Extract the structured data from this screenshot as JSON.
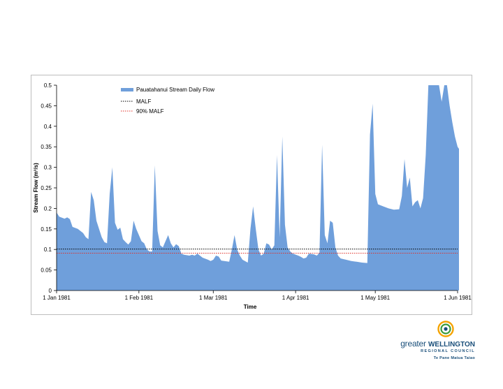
{
  "chart_data": {
    "type": "area",
    "title": "",
    "xlabel": "Time",
    "ylabel": "Stream Flow (m³/s)",
    "ylim": [
      0,
      0.5
    ],
    "y_ticks": [
      "0",
      "0.05",
      "0.1",
      "0.15",
      "0.2",
      "0.25",
      "0.3",
      "0.35",
      "0.4",
      "0.45",
      "0.5"
    ],
    "x_ticks": [
      "1 Jan 1981",
      "1 Feb 1981",
      "1 Mar 1981",
      "1 Apr 1981",
      "1 May 1981",
      "1 Jun 1981"
    ],
    "x_range": [
      "1981-01-01",
      "1981-06-01"
    ],
    "grid": false,
    "legend_position": "top-left",
    "series": [
      {
        "name": "Pauatahanui Stream Daily Flow",
        "style": "area",
        "color": "#6f9fdb",
        "points": [
          [
            "1981-01-01",
            0.19
          ],
          [
            "1981-01-02",
            0.18
          ],
          [
            "1981-01-04",
            0.175
          ],
          [
            "1981-01-05",
            0.178
          ],
          [
            "1981-01-06",
            0.174
          ],
          [
            "1981-01-07",
            0.155
          ],
          [
            "1981-01-09",
            0.15
          ],
          [
            "1981-01-11",
            0.14
          ],
          [
            "1981-01-12",
            0.13
          ],
          [
            "1981-01-13",
            0.125
          ],
          [
            "1981-01-14",
            0.24
          ],
          [
            "1981-01-15",
            0.22
          ],
          [
            "1981-01-16",
            0.17
          ],
          [
            "1981-01-18",
            0.13
          ],
          [
            "1981-01-19",
            0.118
          ],
          [
            "1981-01-20",
            0.115
          ],
          [
            "1981-01-21",
            0.235
          ],
          [
            "1981-01-22",
            0.3
          ],
          [
            "1981-01-23",
            0.165
          ],
          [
            "1981-01-24",
            0.148
          ],
          [
            "1981-01-25",
            0.153
          ],
          [
            "1981-01-26",
            0.125
          ],
          [
            "1981-01-27",
            0.118
          ],
          [
            "1981-01-28",
            0.112
          ],
          [
            "1981-01-29",
            0.12
          ],
          [
            "1981-01-30",
            0.17
          ],
          [
            "1981-01-31",
            0.15
          ],
          [
            "1981-02-02",
            0.12
          ],
          [
            "1981-02-03",
            0.115
          ],
          [
            "1981-02-04",
            0.1
          ],
          [
            "1981-02-05",
            0.095
          ],
          [
            "1981-02-06",
            0.095
          ],
          [
            "1981-02-07",
            0.305
          ],
          [
            "1981-02-08",
            0.145
          ],
          [
            "1981-02-09",
            0.11
          ],
          [
            "1981-02-10",
            0.105
          ],
          [
            "1981-02-11",
            0.12
          ],
          [
            "1981-02-12",
            0.135
          ],
          [
            "1981-02-13",
            0.115
          ],
          [
            "1981-02-14",
            0.105
          ],
          [
            "1981-02-15",
            0.113
          ],
          [
            "1981-02-16",
            0.108
          ],
          [
            "1981-02-17",
            0.09
          ],
          [
            "1981-02-18",
            0.087
          ],
          [
            "1981-02-20",
            0.085
          ],
          [
            "1981-02-21",
            0.087
          ],
          [
            "1981-02-22",
            0.085
          ],
          [
            "1981-02-23",
            0.09
          ],
          [
            "1981-02-25",
            0.08
          ],
          [
            "1981-02-27",
            0.075
          ],
          [
            "1981-02-28",
            0.072
          ],
          [
            "1981-03-01",
            0.075
          ],
          [
            "1981-03-02",
            0.085
          ],
          [
            "1981-03-03",
            0.083
          ],
          [
            "1981-03-04",
            0.073
          ],
          [
            "1981-03-07",
            0.07
          ],
          [
            "1981-03-08",
            0.1
          ],
          [
            "1981-03-09",
            0.135
          ],
          [
            "1981-03-10",
            0.1
          ],
          [
            "1981-03-11",
            0.085
          ],
          [
            "1981-03-12",
            0.075
          ],
          [
            "1981-03-14",
            0.068
          ],
          [
            "1981-03-15",
            0.15
          ],
          [
            "1981-03-16",
            0.205
          ],
          [
            "1981-03-17",
            0.15
          ],
          [
            "1981-03-18",
            0.1
          ],
          [
            "1981-03-19",
            0.085
          ],
          [
            "1981-03-20",
            0.09
          ],
          [
            "1981-03-21",
            0.115
          ],
          [
            "1981-03-22",
            0.112
          ],
          [
            "1981-03-23",
            0.1
          ],
          [
            "1981-03-24",
            0.11
          ],
          [
            "1981-03-25",
            0.33
          ],
          [
            "1981-03-26",
            0.13
          ],
          [
            "1981-03-27",
            0.375
          ],
          [
            "1981-03-28",
            0.16
          ],
          [
            "1981-03-29",
            0.105
          ],
          [
            "1981-03-30",
            0.095
          ],
          [
            "1981-03-31",
            0.09
          ],
          [
            "1981-04-02",
            0.085
          ],
          [
            "1981-04-03",
            0.082
          ],
          [
            "1981-04-04",
            0.078
          ],
          [
            "1981-04-05",
            0.08
          ],
          [
            "1981-04-06",
            0.09
          ],
          [
            "1981-04-08",
            0.088
          ],
          [
            "1981-04-09",
            0.085
          ],
          [
            "1981-04-10",
            0.092
          ],
          [
            "1981-04-11",
            0.355
          ],
          [
            "1981-04-12",
            0.135
          ],
          [
            "1981-04-13",
            0.115
          ],
          [
            "1981-04-14",
            0.17
          ],
          [
            "1981-04-15",
            0.165
          ],
          [
            "1981-04-16",
            0.105
          ],
          [
            "1981-04-17",
            0.085
          ],
          [
            "1981-04-18",
            0.078
          ],
          [
            "1981-04-20",
            0.075
          ],
          [
            "1981-04-22",
            0.072
          ],
          [
            "1981-04-24",
            0.07
          ],
          [
            "1981-04-26",
            0.068
          ],
          [
            "1981-04-28",
            0.067
          ],
          [
            "1981-04-29",
            0.38
          ],
          [
            "1981-04-30",
            0.455
          ],
          [
            "1981-05-01",
            0.235
          ],
          [
            "1981-05-02",
            0.21
          ],
          [
            "1981-05-04",
            0.205
          ],
          [
            "1981-05-06",
            0.2
          ],
          [
            "1981-05-08",
            0.197
          ],
          [
            "1981-05-10",
            0.198
          ],
          [
            "1981-05-11",
            0.23
          ],
          [
            "1981-05-12",
            0.32
          ],
          [
            "1981-05-13",
            0.25
          ],
          [
            "1981-05-14",
            0.275
          ],
          [
            "1981-05-15",
            0.205
          ],
          [
            "1981-05-16",
            0.215
          ],
          [
            "1981-05-17",
            0.22
          ],
          [
            "1981-05-18",
            0.2
          ],
          [
            "1981-05-19",
            0.225
          ],
          [
            "1981-05-20",
            0.33
          ],
          [
            "1981-05-21",
            0.5
          ],
          [
            "1981-05-23",
            0.5
          ],
          [
            "1981-05-24",
            0.5
          ],
          [
            "1981-05-25",
            0.5
          ],
          [
            "1981-05-26",
            0.46
          ],
          [
            "1981-05-27",
            0.5
          ],
          [
            "1981-05-28",
            0.5
          ],
          [
            "1981-05-29",
            0.45
          ],
          [
            "1981-05-30",
            0.41
          ],
          [
            "1981-05-31",
            0.375
          ],
          [
            "1981-06-01",
            0.35
          ],
          [
            "1981-06-02",
            0.345
          ]
        ]
      },
      {
        "name": "MALF",
        "style": "dotted-line",
        "color": "#000000",
        "value": 0.101
      },
      {
        "name": "90% MALF",
        "style": "dotted-line",
        "color": "#e0302a",
        "value": 0.0909
      }
    ]
  },
  "logo": {
    "word_greater": "greater",
    "word_wellington": "WELLINGTON",
    "council": "REGIONAL COUNCIL",
    "maori": "Te Pane Matua Taiao",
    "mark_colors": [
      "#f4a300",
      "#3b9b3a",
      "#1a4f7a"
    ]
  }
}
